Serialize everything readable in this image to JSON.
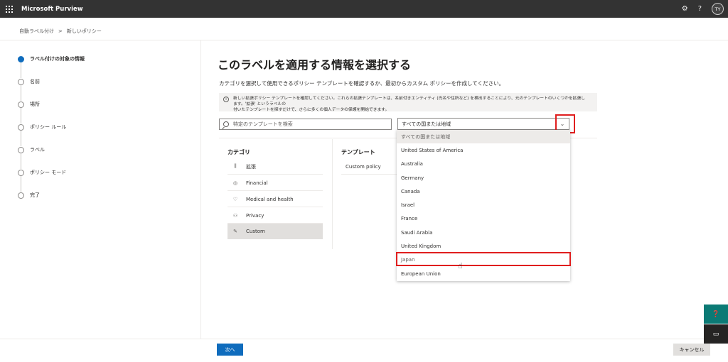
{
  "app": {
    "title": "Microsoft Purview",
    "user_initials": "TY"
  },
  "icons": {
    "waffle": "waffle-icon",
    "settings": "gear-icon",
    "help": "help-icon"
  },
  "breadcrumb": {
    "parent": "自動ラベル付け",
    "separator": ">",
    "current": "新しいポリシー"
  },
  "steps": [
    {
      "label": "ラベル付けの対象の情報",
      "active": true
    },
    {
      "label": "名前",
      "active": false
    },
    {
      "label": "場所",
      "active": false
    },
    {
      "label": "ポリシー ルール",
      "active": false
    },
    {
      "label": "ラベル",
      "active": false
    },
    {
      "label": "ポリシー モード",
      "active": false
    },
    {
      "label": "完了",
      "active": false
    }
  ],
  "main": {
    "title": "このラベルを適用する情報を選択する",
    "description": "カテゴリを選択して使用できるポリシー テンプレートを確認するか、最初からカスタム ポリシーを作成してください。",
    "info_line1": "新しい拡張ポリシー テンプレートを確認してください。これらの拡張テンプレートは、名前付きエンティティ (氏名や住所など) を検出することにより、元のテンプレートのいくつかを拡張します。'拡張' というラベルの",
    "info_line2": "付いたテンプレートを探すだけで、さらに多くの個人データの保護を開始できます。",
    "search_placeholder": "特定のテンプレートを検索",
    "country_value": "すべての国または地域",
    "categories_header": "カテゴリ",
    "templates_header": "テンプレート",
    "categories": [
      {
        "label": "拡張",
        "icon": "books-icon",
        "selected": false
      },
      {
        "label": "Financial",
        "icon": "coins-icon",
        "selected": false
      },
      {
        "label": "Medical and health",
        "icon": "stethoscope-icon",
        "selected": false
      },
      {
        "label": "Privacy",
        "icon": "people-icon",
        "selected": false
      },
      {
        "label": "Custom",
        "icon": "pencil-icon",
        "selected": true
      }
    ],
    "templates": [
      {
        "label": "Custom policy"
      }
    ]
  },
  "dropdown_options": [
    "すべての国または地域",
    "United States of America",
    "Australia",
    "Germany",
    "Canada",
    "Israel",
    "France",
    "Saudi Arabia",
    "United Kingdom",
    "Japan",
    "European Union"
  ],
  "dropdown_highlighted": "Japan",
  "footer": {
    "next_label": "次へ",
    "cancel_label": "キャンセル"
  },
  "colors": {
    "accent": "#0f6cbd",
    "highlight": "#e01e1e",
    "topbar": "#333333"
  }
}
